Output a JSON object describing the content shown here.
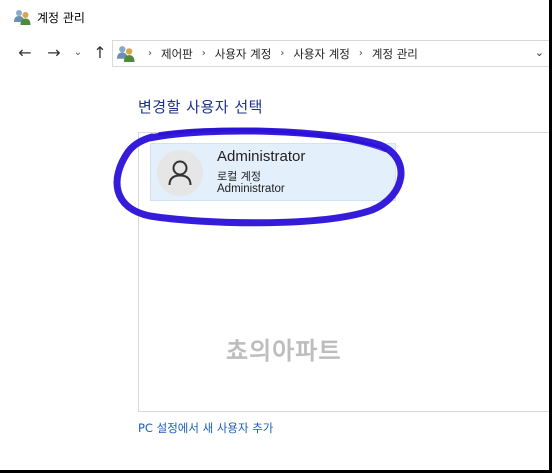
{
  "window": {
    "title": "계정 관리"
  },
  "navigation": {
    "back_icon": "arrow-left-icon",
    "forward_icon": "arrow-right-icon",
    "recent_icon": "chevron-down-icon",
    "up_icon": "arrow-up-icon"
  },
  "address_bar": {
    "breadcrumbs": [
      "제어판",
      "사용자 계정",
      "사용자 계정",
      "계정 관리"
    ],
    "separator": "›"
  },
  "main": {
    "heading": "변경할 사용자 선택",
    "accounts": [
      {
        "name": "Administrator",
        "type": "로컬 계정",
        "group": "Administrator",
        "icon": "user-avatar-icon"
      }
    ],
    "add_user_link": "PC 설정에서 새 사용자 추가"
  },
  "overlay": {
    "watermark": "쵸의아파트",
    "highlight_color": "#2a10d8"
  },
  "colors": {
    "heading": "#1e3287",
    "link": "#1c5fb4",
    "selected_card": "#e3effa"
  }
}
